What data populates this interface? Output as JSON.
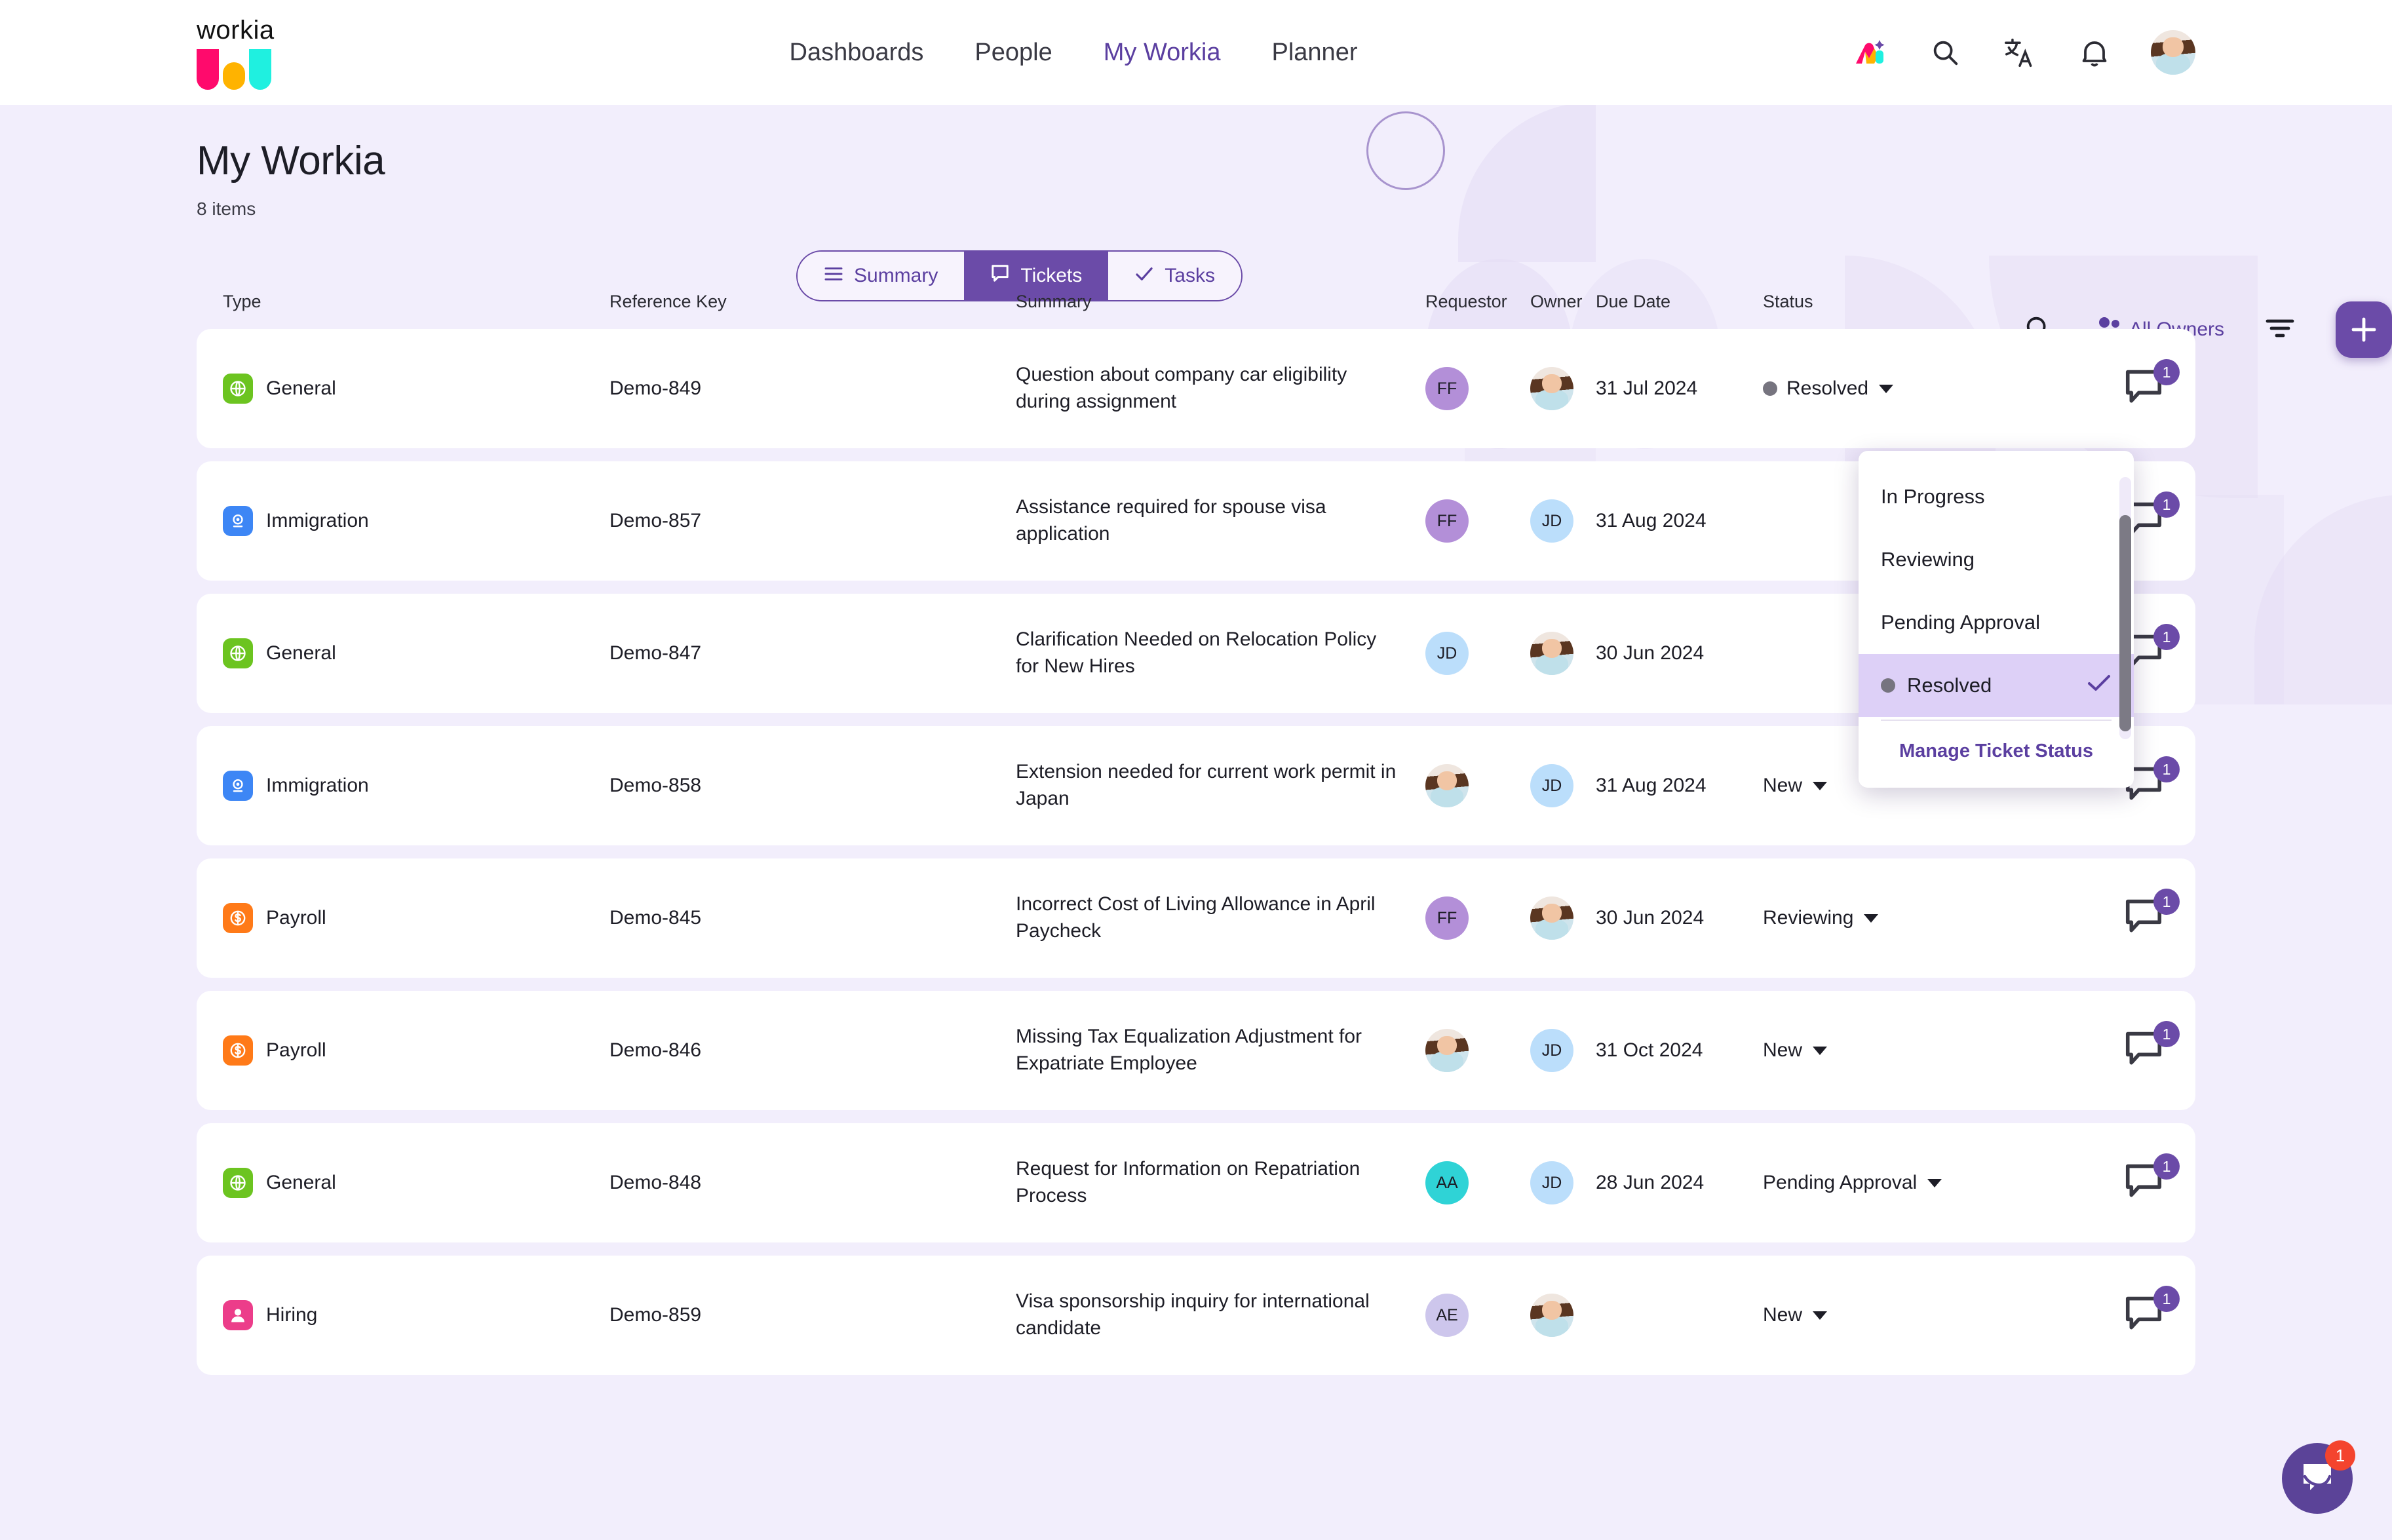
{
  "brand": {
    "wordmark": "workia",
    "colors": {
      "pink": "#ff0a6c",
      "yellow": "#ffb300",
      "cyan": "#1ff0e0",
      "accent": "#6b4ba8"
    }
  },
  "nav": {
    "items": [
      {
        "label": "Dashboards",
        "active": false
      },
      {
        "label": "People",
        "active": false
      },
      {
        "label": "My Workia",
        "active": true
      },
      {
        "label": "Planner",
        "active": false
      }
    ],
    "icons": [
      "ai-sparkle-icon",
      "search-icon",
      "translate-icon",
      "notifications-bell-icon",
      "user-avatar"
    ]
  },
  "header": {
    "title": "My Workia",
    "count": "8 items"
  },
  "tabs": [
    {
      "label": "Summary",
      "icon": "list-icon",
      "active": false
    },
    {
      "label": "Tickets",
      "icon": "chat-bubble-icon",
      "active": true
    },
    {
      "label": "Tasks",
      "icon": "check-icon",
      "active": false
    }
  ],
  "toolbar": {
    "search_icon": "search-icon",
    "owners_label": "All Owners",
    "owners_icon": "people-icon",
    "filter_icon": "filter-icon",
    "add_label": "+"
  },
  "table": {
    "columns": [
      "Type",
      "Reference Key",
      "Summary",
      "Requestor",
      "Owner",
      "Due Date",
      "Status"
    ],
    "rows": [
      {
        "type": "General",
        "type_color": "#6cc420",
        "type_icon": "globe-icon",
        "ref": "Demo-849",
        "summary": "Question about company car eligibility during assignment",
        "requestor": {
          "kind": "initials",
          "text": "FF",
          "color": "#b38fd8"
        },
        "owner": {
          "kind": "photo",
          "text": ""
        },
        "due": "31 Jul 2024",
        "status": "Resolved",
        "status_dot": true,
        "comments": "1"
      },
      {
        "type": "Immigration",
        "type_color": "#3d86f5",
        "type_icon": "passport-icon",
        "ref": "Demo-857",
        "summary": "Assistance required for spouse visa application",
        "requestor": {
          "kind": "initials",
          "text": "FF",
          "color": "#b38fd8"
        },
        "owner": {
          "kind": "initials",
          "text": "JD",
          "color": "#bbdefb"
        },
        "due": "31 Aug 2024",
        "status": "",
        "status_dot": false,
        "comments": "1"
      },
      {
        "type": "General",
        "type_color": "#6cc420",
        "type_icon": "globe-icon",
        "ref": "Demo-847",
        "summary": "Clarification Needed on Relocation Policy for New Hires",
        "requestor": {
          "kind": "initials",
          "text": "JD",
          "color": "#bbdefb"
        },
        "owner": {
          "kind": "photo",
          "text": ""
        },
        "due": "30 Jun 2024",
        "status": "",
        "status_dot": false,
        "comments": "1"
      },
      {
        "type": "Immigration",
        "type_color": "#3d86f5",
        "type_icon": "passport-icon",
        "ref": "Demo-858",
        "summary": "Extension needed for current work permit in Japan",
        "requestor": {
          "kind": "photo",
          "text": ""
        },
        "owner": {
          "kind": "initials",
          "text": "JD",
          "color": "#bbdefb"
        },
        "due": "31 Aug 2024",
        "status": "New",
        "status_dot": false,
        "comments": "1"
      },
      {
        "type": "Payroll",
        "type_color": "#ff7a18",
        "type_icon": "dollar-icon",
        "ref": "Demo-845",
        "summary": "Incorrect Cost of Living Allowance in April Paycheck",
        "requestor": {
          "kind": "initials",
          "text": "FF",
          "color": "#b38fd8"
        },
        "owner": {
          "kind": "photo",
          "text": ""
        },
        "due": "30 Jun 2024",
        "status": "Reviewing",
        "status_dot": false,
        "comments": "1"
      },
      {
        "type": "Payroll",
        "type_color": "#ff7a18",
        "type_icon": "dollar-icon",
        "ref": "Demo-846",
        "summary": "Missing Tax Equalization Adjustment for Expatriate Employee",
        "requestor": {
          "kind": "photo",
          "text": ""
        },
        "owner": {
          "kind": "initials",
          "text": "JD",
          "color": "#bbdefb"
        },
        "due": "31 Oct 2024",
        "status": "New",
        "status_dot": false,
        "comments": "1"
      },
      {
        "type": "General",
        "type_color": "#6cc420",
        "type_icon": "globe-icon",
        "ref": "Demo-848",
        "summary": "Request for Information on Repatriation Process",
        "requestor": {
          "kind": "initials",
          "text": "AA",
          "color": "#2fd3d6"
        },
        "owner": {
          "kind": "initials",
          "text": "JD",
          "color": "#bbdefb"
        },
        "due": "28 Jun 2024",
        "status": "Pending Approval",
        "status_dot": false,
        "comments": "1"
      },
      {
        "type": "Hiring",
        "type_color": "#ec3d8a",
        "type_icon": "person-icon",
        "ref": "Demo-859",
        "summary": "Visa sponsorship inquiry for international candidate",
        "requestor": {
          "kind": "initials",
          "text": "AE",
          "color": "#cdc6ec"
        },
        "owner": {
          "kind": "photo",
          "text": ""
        },
        "due": "",
        "status": "New",
        "status_dot": false,
        "comments": "1"
      }
    ]
  },
  "status_dropdown": {
    "open": true,
    "options": [
      {
        "label": "In Progress",
        "selected": false,
        "dot": false
      },
      {
        "label": "Reviewing",
        "selected": false,
        "dot": false
      },
      {
        "label": "Pending Approval",
        "selected": false,
        "dot": false
      },
      {
        "label": "Resolved",
        "selected": true,
        "dot": true
      }
    ],
    "footer_link": "Manage Ticket Status"
  },
  "intercom": {
    "badge": "1",
    "icon": "chat-smile-icon"
  }
}
